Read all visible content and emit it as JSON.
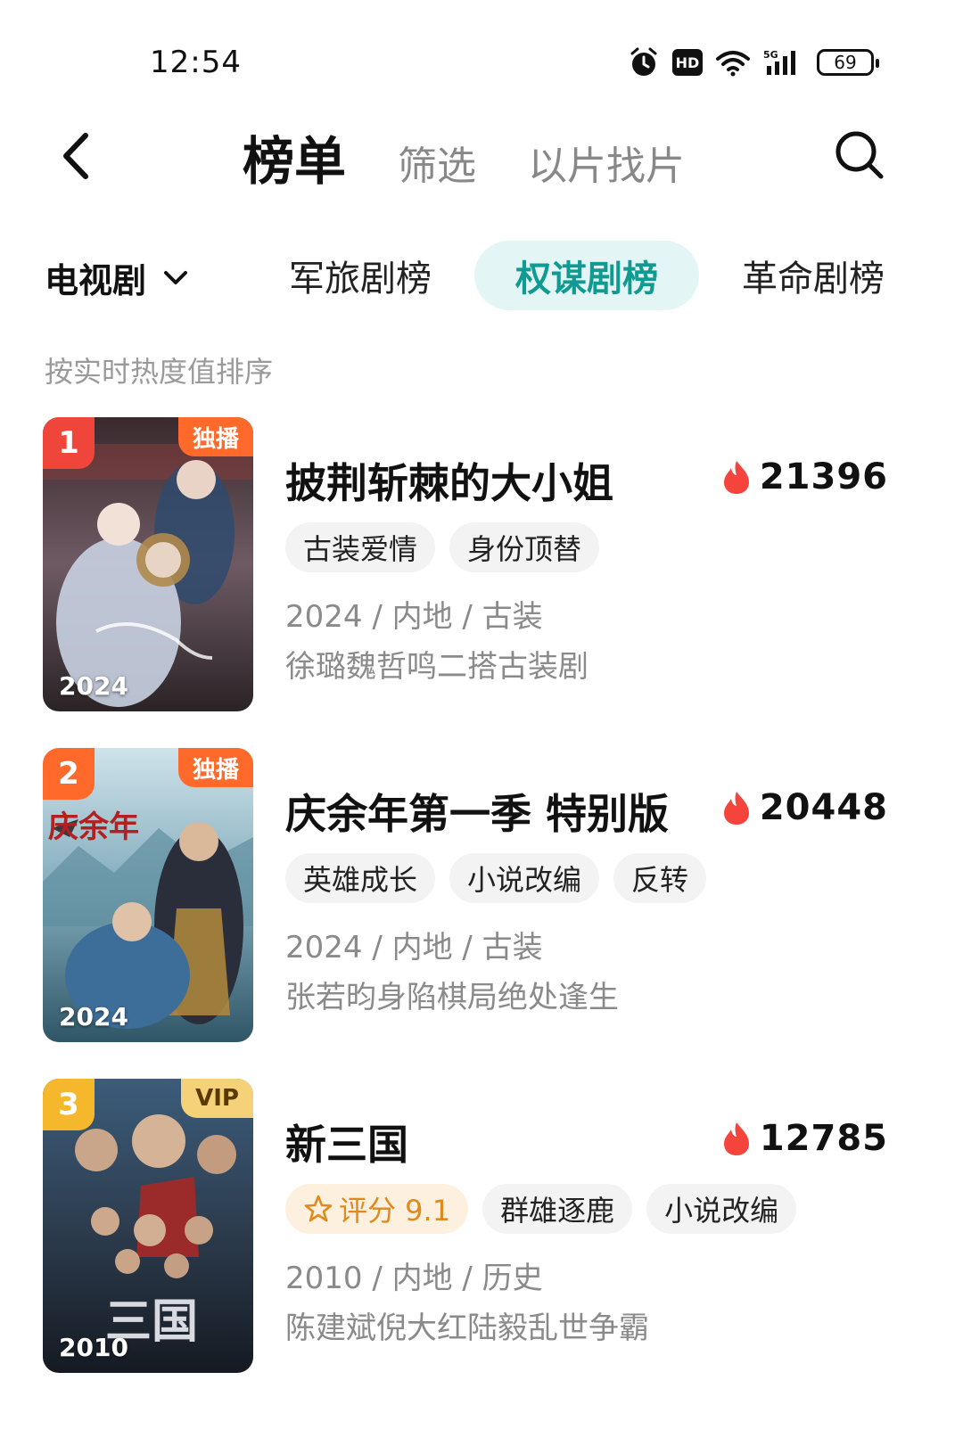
{
  "status_bar": {
    "time": "12:54",
    "network": "5G",
    "battery": "69"
  },
  "nav": {
    "tabs": [
      {
        "label": "榜单",
        "active": true
      },
      {
        "label": "筛选",
        "active": false
      },
      {
        "label": "以片找片",
        "active": false
      }
    ]
  },
  "category": {
    "selected": "电视剧"
  },
  "subtabs": [
    {
      "label": "军旅剧榜",
      "active": false
    },
    {
      "label": "权谋剧榜",
      "active": true
    },
    {
      "label": "革命剧榜",
      "active": false
    }
  ],
  "sort_note": "按实时热度值排序",
  "items": [
    {
      "rank": "1",
      "badge": "独播",
      "poster_year": "2024",
      "title": "披荆斩棘的大小姐",
      "heat": "21396",
      "tags": [
        "古装爱情",
        "身份顶替"
      ],
      "meta": "2024 / 内地 / 古装",
      "desc": "徐璐魏哲鸣二搭古装剧"
    },
    {
      "rank": "2",
      "badge": "独播",
      "poster_year": "2024",
      "title": "庆余年第一季 特别版",
      "heat": "20448",
      "tags": [
        "英雄成长",
        "小说改编",
        "反转"
      ],
      "meta": "2024 / 内地 / 古装",
      "desc": "张若昀身陷棋局绝处逢生"
    },
    {
      "rank": "3",
      "badge": "VIP",
      "poster_year": "2010",
      "title": "新三国",
      "heat": "12785",
      "rating": "评分 9.1",
      "tags": [
        "群雄逐鹿",
        "小说改编"
      ],
      "meta": "2010 / 内地 / 历史",
      "desc": "陈建斌倪大红陆毅乱世争霸"
    }
  ],
  "colors": {
    "accent": "#0f9b92",
    "accent_bg": "#e3f5f4",
    "rank_1": "#f0453a",
    "rank_2": "#ff6a2b",
    "rank_3": "#f5b72c",
    "heat_icon": "#f5443b"
  }
}
